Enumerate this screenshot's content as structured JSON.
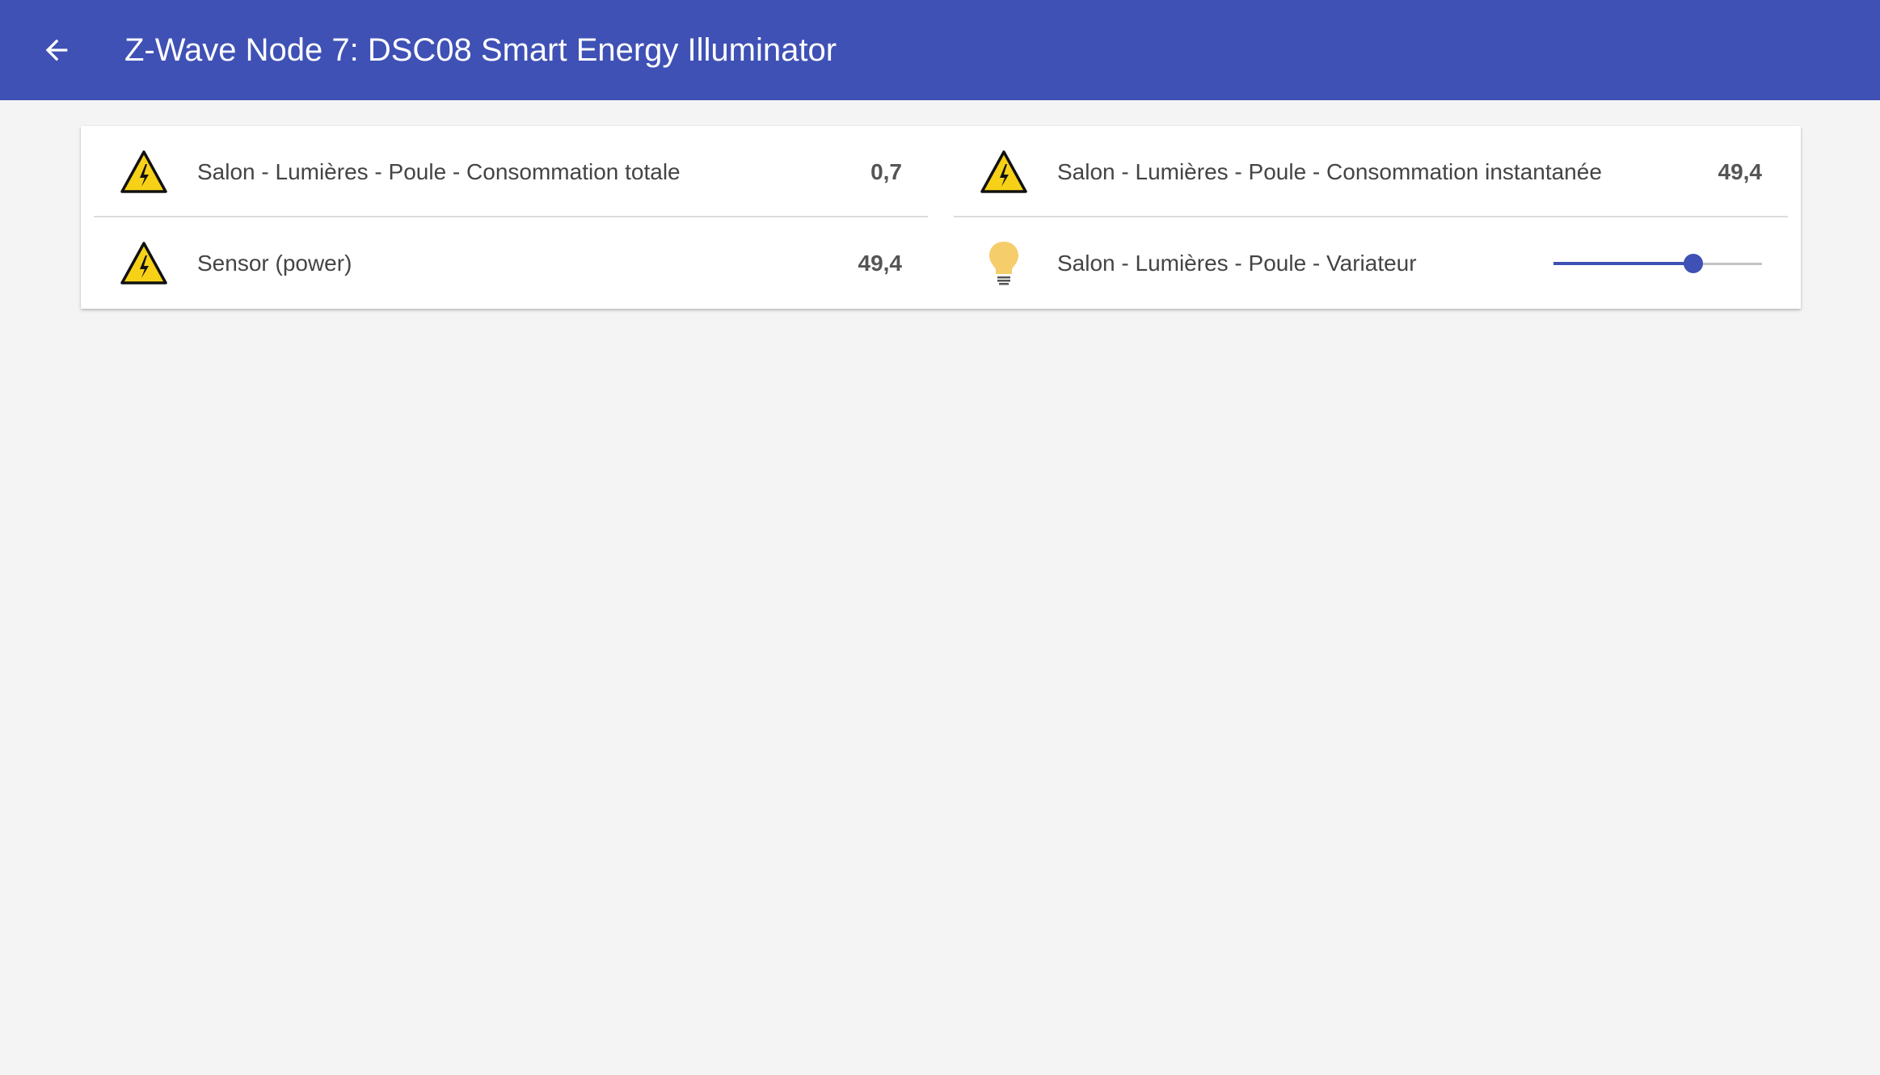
{
  "header": {
    "title": "Z-Wave Node 7: DSC08 Smart Energy Illuminator",
    "back_icon": "arrow-left-icon",
    "background_color": "#3f51b5"
  },
  "entities": [
    {
      "label": "Salon - Lumières - Poule - Consommation totale",
      "value": "0,7",
      "icon": "high-voltage-warning-icon"
    },
    {
      "label": "Salon - Lumières - Poule - Consommation instantanée",
      "value": "49,4",
      "icon": "high-voltage-warning-icon"
    },
    {
      "label": "Sensor (power)",
      "value": "49,4",
      "icon": "high-voltage-warning-icon"
    },
    {
      "label": "Salon - Lumières - Poule - Variateur",
      "icon": "lightbulb-icon",
      "icon_color": "#f5cd6a",
      "slider_level": 0.67,
      "slider_color": "#3f51b5"
    }
  ]
}
